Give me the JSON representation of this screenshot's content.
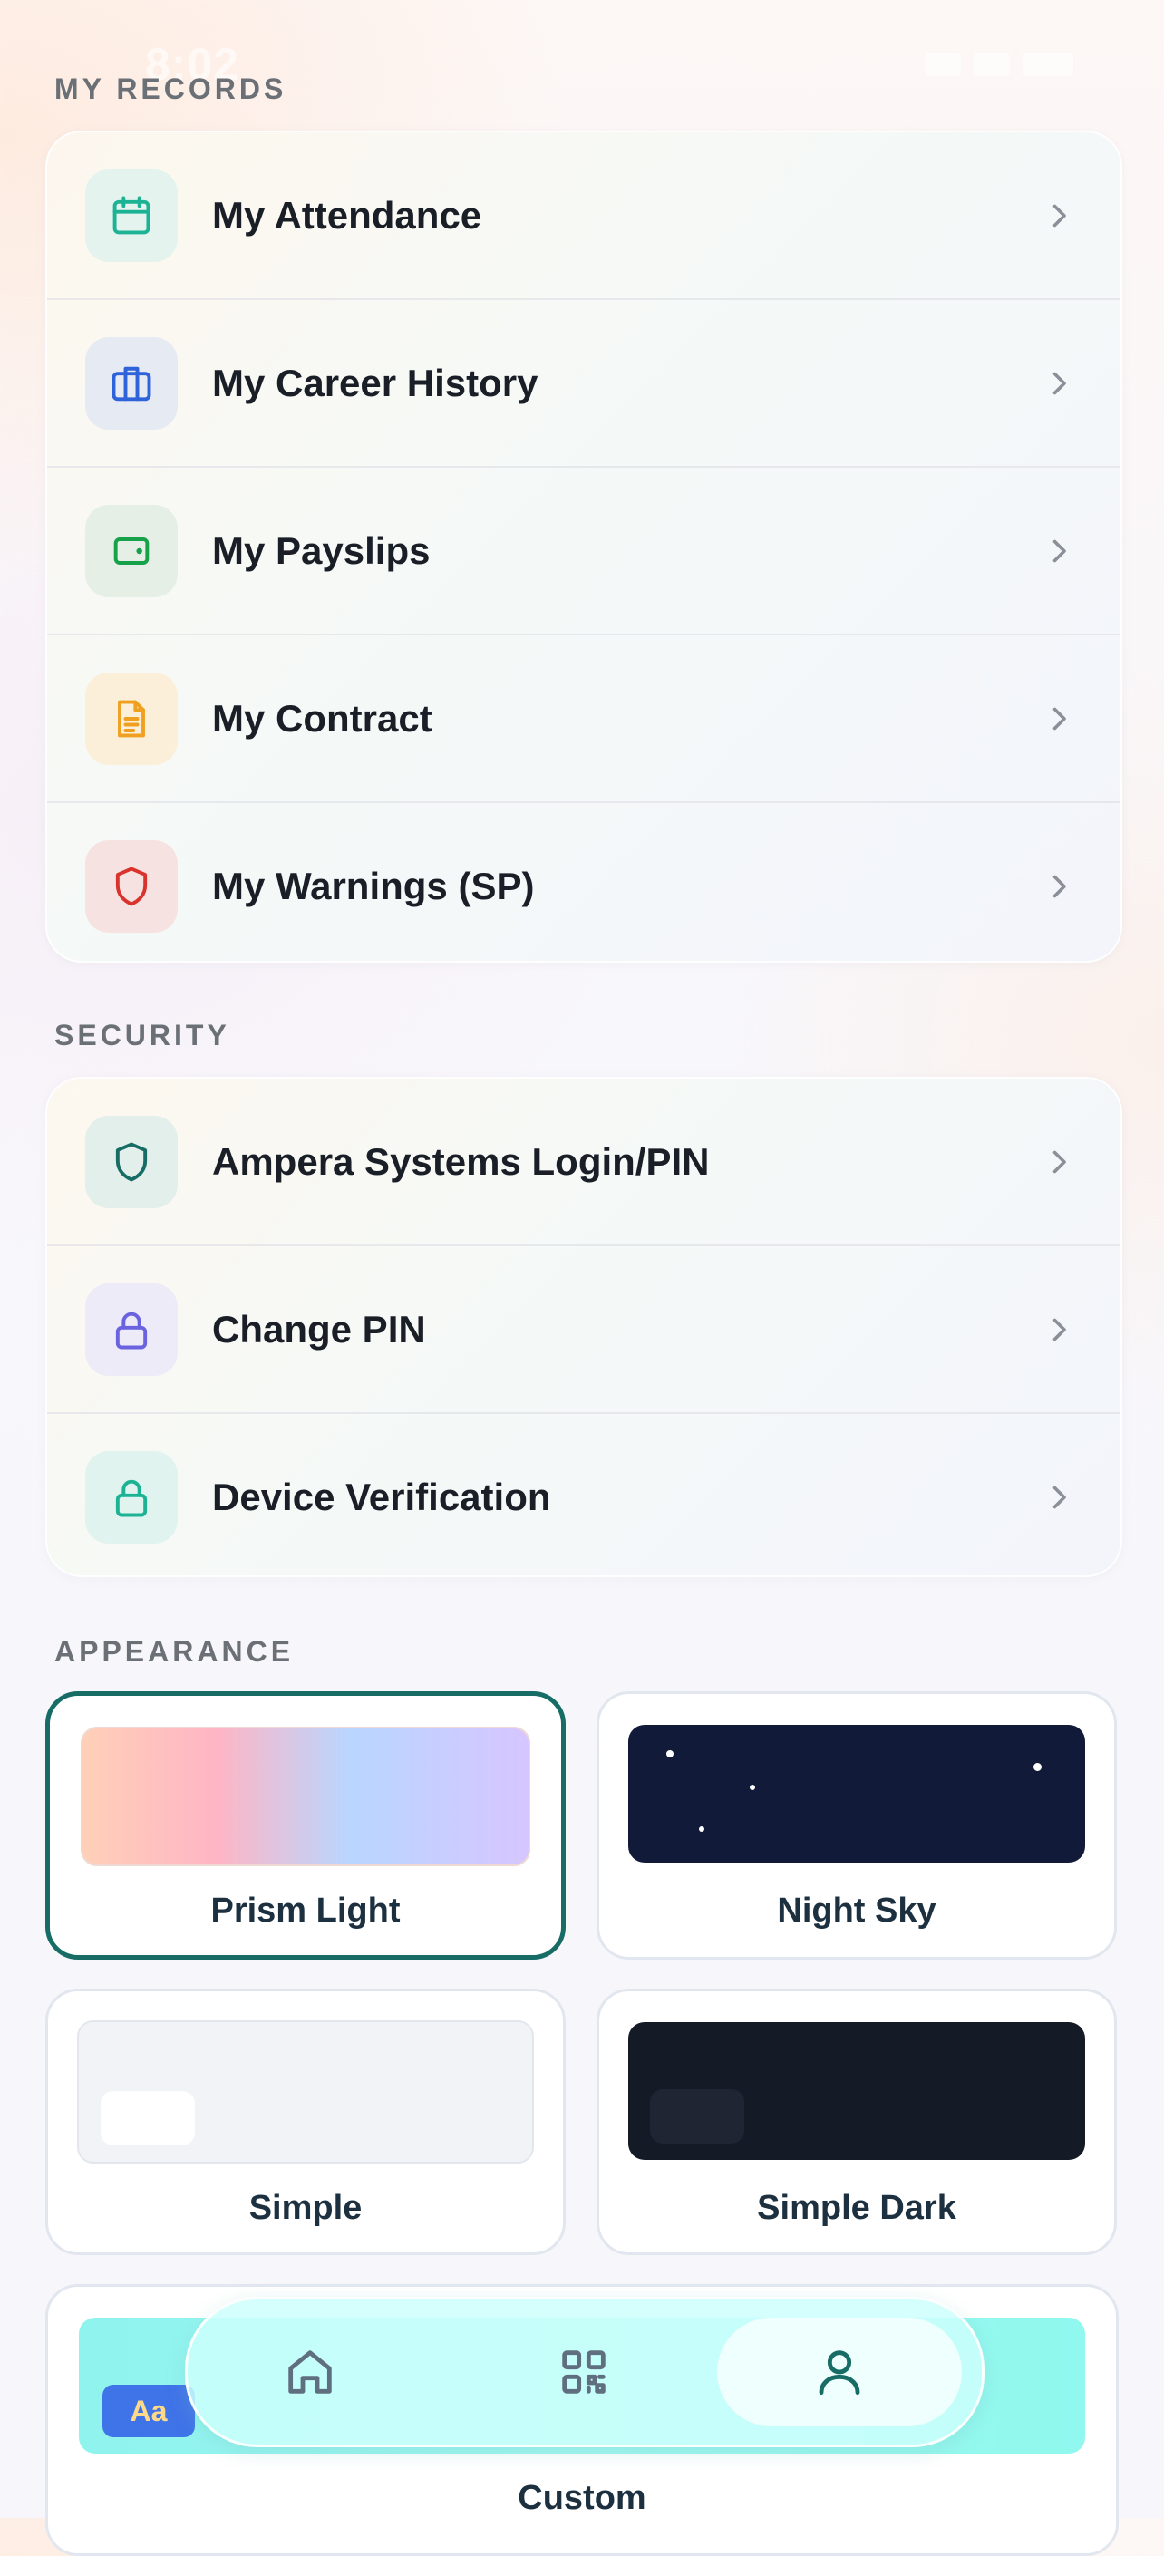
{
  "status_bar": {
    "time": "8:02"
  },
  "sections": {
    "records": {
      "label": "MY RECORDS",
      "items": [
        {
          "label": "My Attendance",
          "icon": "calendar-icon",
          "color": "#1bb394",
          "bg": "#e4f3ee"
        },
        {
          "label": "My Career History",
          "icon": "briefcase-icon",
          "color": "#2f63d9",
          "bg": "#e6eaf3"
        },
        {
          "label": "My Payslips",
          "icon": "wallet-icon",
          "color": "#17a14b",
          "bg": "#e5efe5"
        },
        {
          "label": "My Contract",
          "icon": "document-icon",
          "color": "#f0a020",
          "bg": "#fbefd9"
        },
        {
          "label": "My Warnings (SP)",
          "icon": "shield-icon",
          "color": "#d9332e",
          "bg": "#f6e3e1"
        }
      ]
    },
    "security": {
      "label": "SECURITY",
      "items": [
        {
          "label": "Ampera Systems Login/PIN",
          "icon": "shield-icon",
          "color": "#176d66",
          "bg": "#e3efea"
        },
        {
          "label": "Change PIN",
          "icon": "lock-icon",
          "color": "#6a63e0",
          "bg": "#ecebf7"
        },
        {
          "label": "Device Verification",
          "icon": "lock-icon",
          "color": "#1bb394",
          "bg": "#e1f3ee"
        }
      ]
    },
    "appearance": {
      "label": "APPEARANCE",
      "themes": [
        {
          "name": "Prism Light",
          "selected": true
        },
        {
          "name": "Night Sky",
          "selected": false
        },
        {
          "name": "Simple",
          "selected": false
        },
        {
          "name": "Simple Dark",
          "selected": false
        },
        {
          "name": "Custom",
          "selected": false,
          "badge": "Aa"
        }
      ]
    }
  },
  "bottom_nav": {
    "items": [
      {
        "icon": "home-icon",
        "active": false
      },
      {
        "icon": "qr-grid-icon",
        "active": false
      },
      {
        "icon": "profile-icon",
        "active": true
      }
    ]
  },
  "colors": {
    "accent": "#176d66",
    "chevron": "#8a8f98"
  }
}
